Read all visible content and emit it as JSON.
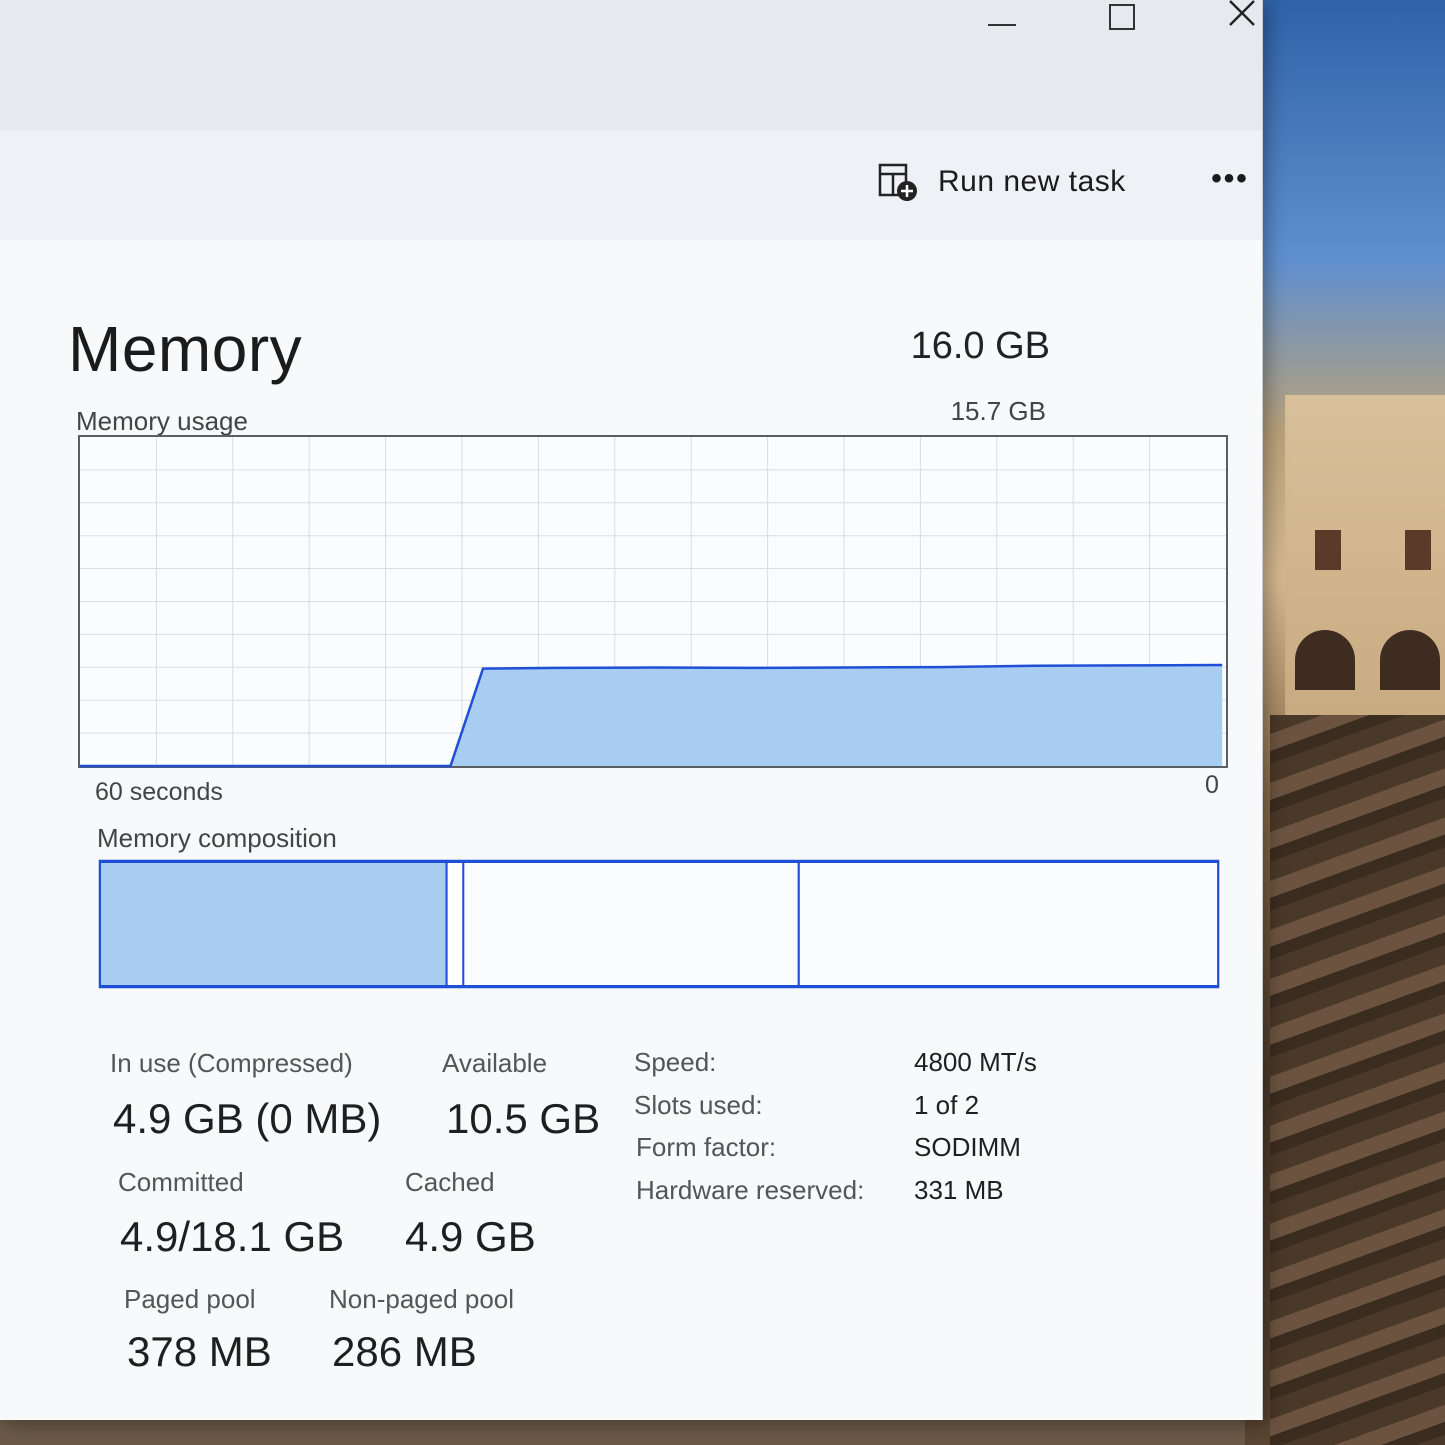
{
  "window": {
    "commands": {
      "run_new_task": "Run new task",
      "more": "•••"
    }
  },
  "memory": {
    "title": "Memory",
    "total": "16.0 GB",
    "usage_label": "Memory usage",
    "usage_max": "15.7 GB",
    "axis_left": "60 seconds",
    "axis_right": "0",
    "composition_label": "Memory composition",
    "composition": {
      "in_use_fraction": 0.31,
      "modified_fraction": 0.015,
      "standby_fraction": 0.3,
      "free_fraction": 0.375
    }
  },
  "stats": {
    "in_use_label": "In use (Compressed)",
    "in_use_value": "4.9 GB (0 MB)",
    "available_label": "Available",
    "available_value": "10.5 GB",
    "committed_label": "Committed",
    "committed_value": "4.9/18.1 GB",
    "cached_label": "Cached",
    "cached_value": "4.9 GB",
    "paged_pool_label": "Paged pool",
    "paged_pool_value": "378 MB",
    "nonpaged_pool_label": "Non-paged pool",
    "nonpaged_pool_value": "286 MB"
  },
  "info": {
    "speed_label": "Speed:",
    "speed_value": "4800 MT/s",
    "slots_label": "Slots used:",
    "slots_value": "1 of 2",
    "form_label": "Form factor:",
    "form_value": "SODIMM",
    "hw_reserved_label": "Hardware reserved:",
    "hw_reserved_value": "331 MB"
  },
  "chart_data": {
    "type": "area",
    "x_range_seconds": [
      60,
      0
    ],
    "ylim_gb": [
      0,
      15.7
    ],
    "series": [
      {
        "x": [
          60,
          40.6,
          38.9,
          35,
          30,
          25,
          20,
          15,
          10,
          5,
          0.2
        ],
        "values": [
          0,
          0,
          4.65,
          4.68,
          4.7,
          4.68,
          4.7,
          4.72,
          4.78,
          4.8,
          4.82
        ]
      }
    ],
    "grid": true
  },
  "colors": {
    "accent": "#1f4fd6",
    "fill": "#a9cdf0",
    "grid": "#d8dde3"
  }
}
